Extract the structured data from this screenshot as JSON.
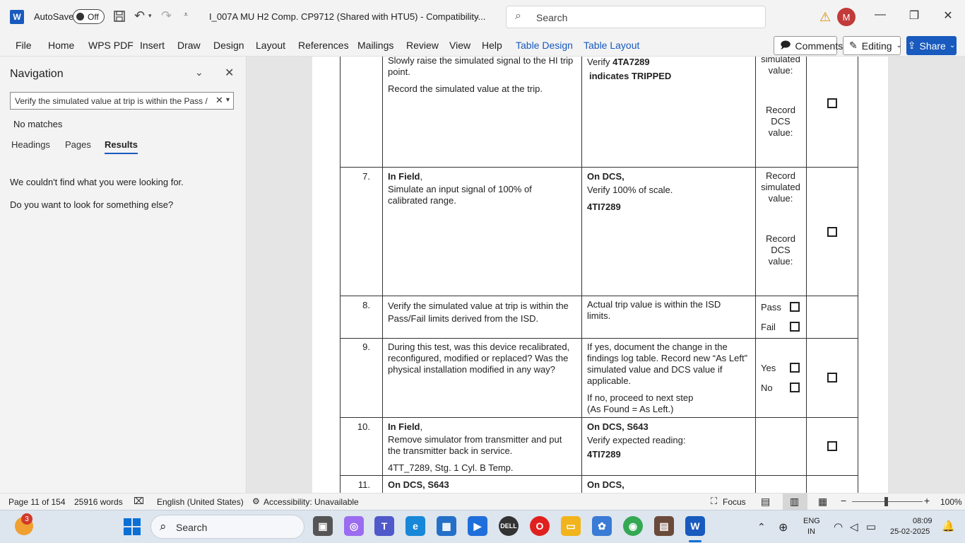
{
  "titlebar": {
    "autosave_label": "AutoSave",
    "autosave_state": "Off",
    "doc_title": "I_007A MU H2 Comp. CP9712 (Shared with HTU5)  -  Compatibility...",
    "search_placeholder": "Search",
    "avatar_initial": "M"
  },
  "ribbon": {
    "tabs": [
      "File",
      "Home",
      "WPS PDF",
      "Insert",
      "Draw",
      "Design",
      "Layout",
      "References",
      "Mailings",
      "Review",
      "View",
      "Help",
      "Table Design",
      "Table Layout"
    ],
    "comments_label": "Comments",
    "editing_label": "Editing",
    "share_label": "Share"
  },
  "navigation": {
    "title": "Navigation",
    "search_value": "Verify the simulated value at trip is within the Pass /",
    "no_matches": "No matches",
    "tabs": [
      "Headings",
      "Pages",
      "Results"
    ],
    "active_tab": "Results",
    "message1": "We couldn't find what you were looking for.",
    "message2": "Do you want to look for something else?"
  },
  "document": {
    "row6": {
      "action1": "Slowly raise the simulated signal to the HI trip point.",
      "action2": "Record the simulated value at the trip.",
      "expected_prefix": "Verify ",
      "expected_tag": "4TA7289",
      "expected_line2": "indicates TRIPPED",
      "record1": "simulated value:",
      "record2": "Record DCS value:"
    },
    "row7": {
      "num": "7.",
      "action_bold": "In Field",
      "action_comma": ",",
      "action_text": "Simulate an input signal of 100% of calibrated range.",
      "expected_bold": "On DCS,",
      "expected_text": "Verify 100% of scale.",
      "expected_tag": "4TI7289",
      "record1": "Record simulated value:",
      "record2": "Record DCS value:"
    },
    "row8": {
      "num": "8.",
      "action_text": "Verify the simulated value at trip is within the Pass/Fail limits derived from the ISD.",
      "expected_text": "Actual trip value is within the ISD limits.",
      "pass_label": "Pass",
      "fail_label": "Fail"
    },
    "row9": {
      "num": "9.",
      "action_text": "During this test, was this device recalibrated, reconfigured, modified or replaced? Was the physical installation modified in any way?",
      "expected_text1": "If yes, document the change in the findings log table. Record new “As Left” simulated value and DCS value if applicable.",
      "expected_text2": "If no, proceed to next step",
      "expected_text3": "(As Found = As Left.)",
      "yes_label": "Yes",
      "no_label": "No"
    },
    "row10": {
      "num": "10.",
      "action_bold": "In Field",
      "action_comma": ",",
      "action_text": "Remove simulator from transmitter and put the transmitter back in service.",
      "action_text2": "4TT_7289, Stg. 1 Cyl. B Temp.",
      "expected_bold": "On DCS, S643",
      "expected_text": "Verify expected reading:",
      "expected_tag": "4TI7289"
    },
    "row11": {
      "num": "11.",
      "action_bold": "On DCS, S643",
      "expected_bold": "On DCS,"
    }
  },
  "statusbar": {
    "page": "Page 11 of 154",
    "words": "25916 words",
    "language": "English (United States)",
    "accessibility": "Accessibility: Unavailable",
    "focus": "Focus",
    "zoom": "100%"
  },
  "taskbar": {
    "search_label": "Search",
    "weather_badge": "3",
    "lang1": "ENG",
    "lang2": "IN",
    "time": "08:09",
    "date": "25-02-2025"
  }
}
